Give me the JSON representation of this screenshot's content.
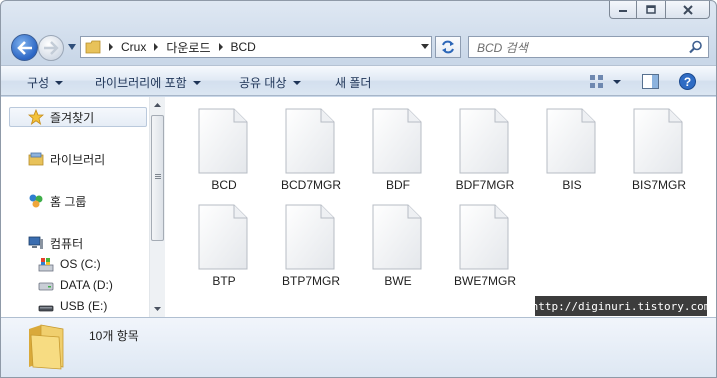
{
  "window": {
    "caption_buttons": [
      {
        "name": "minimize-icon"
      },
      {
        "name": "maximize-icon"
      },
      {
        "name": "close-icon"
      }
    ]
  },
  "address_bar": {
    "breadcrumbs": [
      "Crux",
      "다운로드",
      "BCD"
    ]
  },
  "search": {
    "placeholder": "BCD 검색"
  },
  "toolbar": {
    "organize": "구성",
    "include_in_library": "라이브러리에 포함",
    "share_with": "공유 대상",
    "new_folder": "새 폴더"
  },
  "nav_pane": {
    "favorites": "즐겨찾기",
    "libraries": "라이브러리",
    "homegroup": "홈 그룹",
    "computer": "컴퓨터",
    "drives": [
      "OS (C:)",
      "DATA (D:)",
      "USB (E:)"
    ]
  },
  "files": [
    "BCD",
    "BCD7MGR",
    "BDF",
    "BDF7MGR",
    "BIS",
    "BIS7MGR",
    "BTP",
    "BTP7MGR",
    "BWE",
    "BWE7MGR"
  ],
  "watermark": "http://diginuri.tistory.com",
  "details": {
    "item_count": "10개 항목"
  },
  "colors": {
    "accent": "#2c66c4",
    "folder": "#e8c25a"
  }
}
